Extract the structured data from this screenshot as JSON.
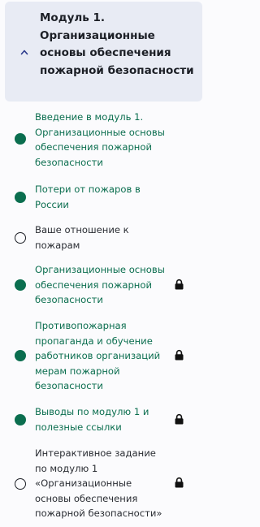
{
  "module": {
    "title": "Модуль 1. Организационные основы обеспечения пожарной безопасности",
    "expand_icon": "chevron-up-icon"
  },
  "lessons": [
    {
      "title": "Введение в модуль 1. Организационные основы обеспечения пожарной безопасности",
      "status": "completed",
      "locked": false
    },
    {
      "title": "Потери от пожаров в России",
      "status": "completed",
      "locked": false
    },
    {
      "title": "Ваше отношение к пожарам",
      "status": "not-started",
      "locked": false
    },
    {
      "title": "Организационные основы обеспечения пожарной безопасности",
      "status": "completed",
      "locked": true
    },
    {
      "title": "Противопожарная пропаганда и обучение работников организаций мерам пожарной безопасности",
      "status": "completed",
      "locked": true
    },
    {
      "title": "Выводы по модулю 1 и полезные ссылки",
      "status": "completed",
      "locked": true
    },
    {
      "title": "Интерактивное задание по модулю 1 «Организационные основы обеспечения пожарной безопасности»",
      "status": "not-started",
      "locked": true
    }
  ],
  "colors": {
    "completed": "#0b6e4f",
    "text": "#2a2d33",
    "header_bg": "#e8ebf4"
  }
}
